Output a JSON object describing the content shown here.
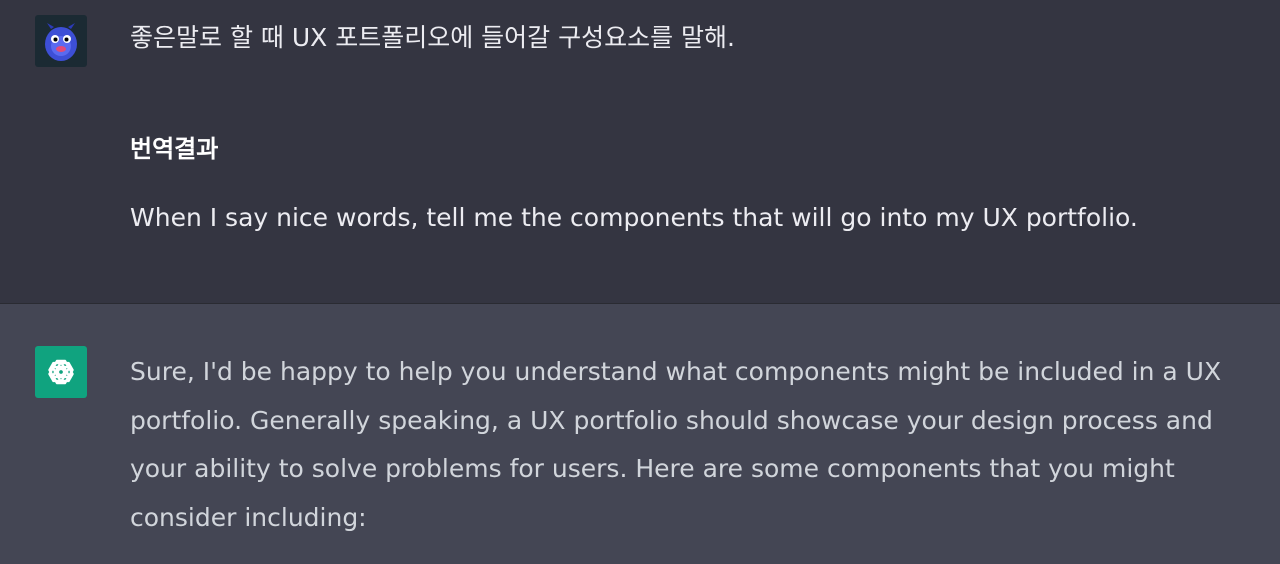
{
  "user_message": {
    "avatar_icon": "monster-avatar-icon",
    "text": "좋은말로 할 때 UX 포트폴리오에 들어갈 구성요소를 말해.",
    "translation_heading": "번역결과",
    "translation_text": "When I say nice words, tell me the components that will go into my UX portfolio."
  },
  "assistant_message": {
    "avatar_icon": "openai-logo-icon",
    "text": "Sure, I'd be happy to help you understand what components might be included in a UX portfolio. Generally speaking, a UX portfolio should showcase your design process and your ability to solve problems for users. Here are some components that you might consider including:"
  },
  "colors": {
    "user_bg": "#343541",
    "assistant_bg": "#444654",
    "accent": "#10a37f"
  }
}
